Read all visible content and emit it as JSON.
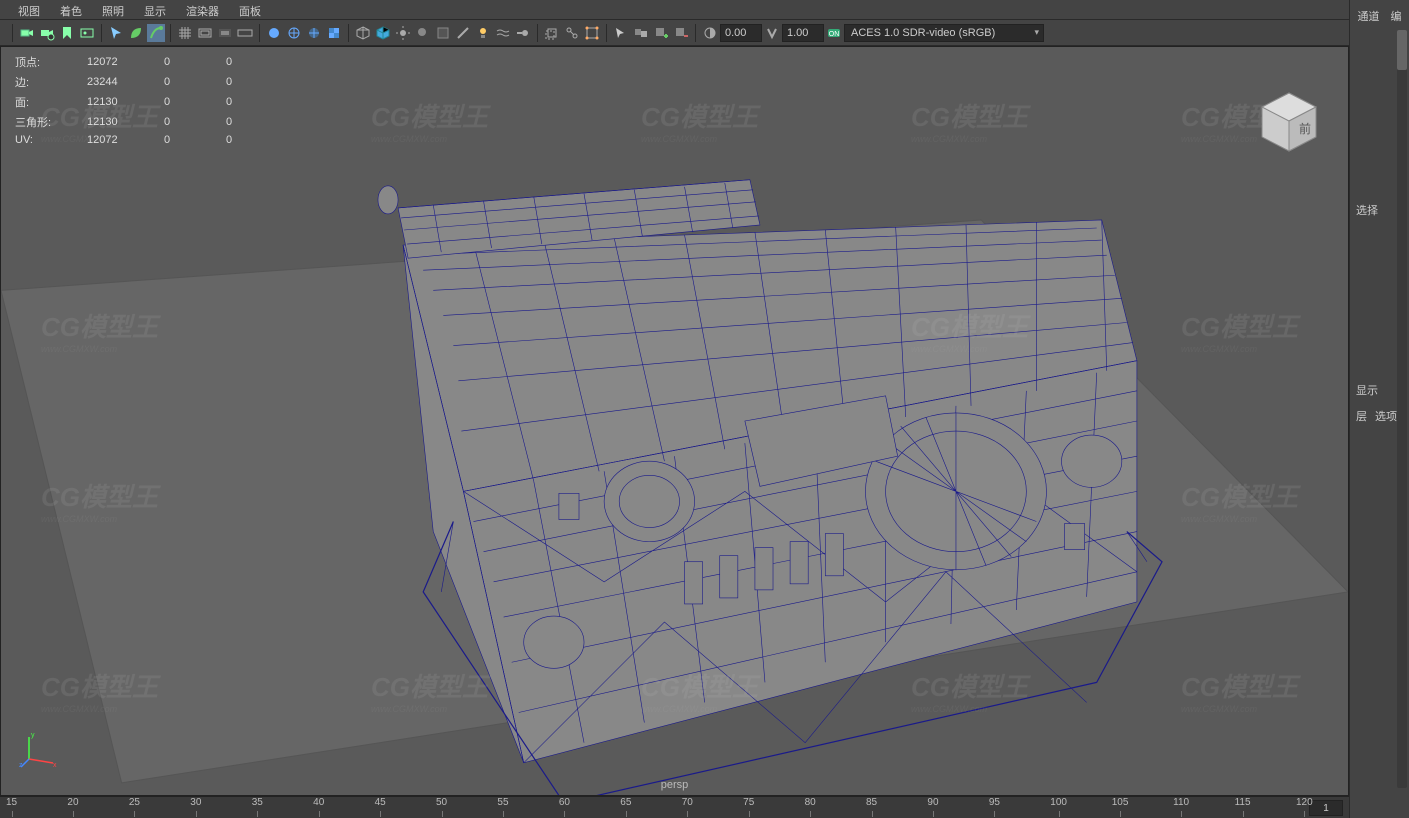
{
  "menubar": {
    "view": "视图",
    "shading": "着色",
    "lighting": "照明",
    "display": "显示",
    "renderer": "渲染器",
    "panels": "面板"
  },
  "toolbar": {
    "val1": "0.00",
    "val2": "1.00",
    "colorspace": "ACES 1.0 SDR-video (sRGB)"
  },
  "stats": {
    "rows": [
      {
        "label": "顶点:",
        "a": "12072",
        "b": "0",
        "c": "0"
      },
      {
        "label": "边:",
        "a": "23244",
        "b": "0",
        "c": "0"
      },
      {
        "label": "面:",
        "a": "12130",
        "b": "0",
        "c": "0"
      },
      {
        "label": "三角形:",
        "a": "12130",
        "b": "0",
        "c": "0"
      },
      {
        "label": "UV:",
        "a": "12072",
        "b": "0",
        "c": "0"
      }
    ]
  },
  "camera": "persp",
  "ruler": {
    "start": 15,
    "end": 120,
    "step": 5,
    "current": "1"
  },
  "right": {
    "tabs": {
      "channels": "通道",
      "edit": "编"
    },
    "select_label": "选择",
    "display_section": "显示",
    "layers": "层",
    "options": "选项"
  },
  "viewcube": {
    "face": "前"
  },
  "watermark": {
    "logo": "CG模型王",
    "url": "www.CGMXW.com"
  }
}
